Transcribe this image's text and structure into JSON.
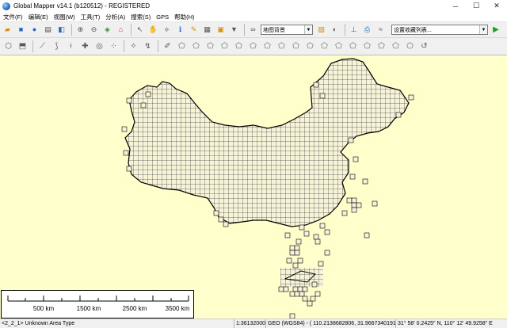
{
  "window": {
    "title": "Global Mapper v14.1 (b120512) - REGISTERED",
    "controls": [
      "─",
      "☐",
      "✕"
    ]
  },
  "menu": {
    "items": [
      "文件(F)",
      "编辑(E)",
      "视图(W)",
      "工具(T)",
      "分析(A)",
      "搜索(S)",
      "GPS",
      "帮助(H)"
    ]
  },
  "toolbar1": {
    "layer_combo": "地图背景",
    "projection_combo": "设置收藏列表..."
  },
  "scale_bar": {
    "labels": [
      "500 km",
      "1500 km",
      "2500 km",
      "3500 km"
    ]
  },
  "status_bar": {
    "layer": "<2_2_1> Unknown Area Type",
    "scale": "1:36132000",
    "coordinates": "GEO (WGS84) - ( 110.2138682806, 31.9667340191 )",
    "dms": "31° 58' 0.2425\" N, 110° 12' 49.9258\" E"
  },
  "colors": {
    "map_background": "#ffffcc",
    "grid_fill": "#f5f3d8",
    "grid_line": "#000000"
  }
}
